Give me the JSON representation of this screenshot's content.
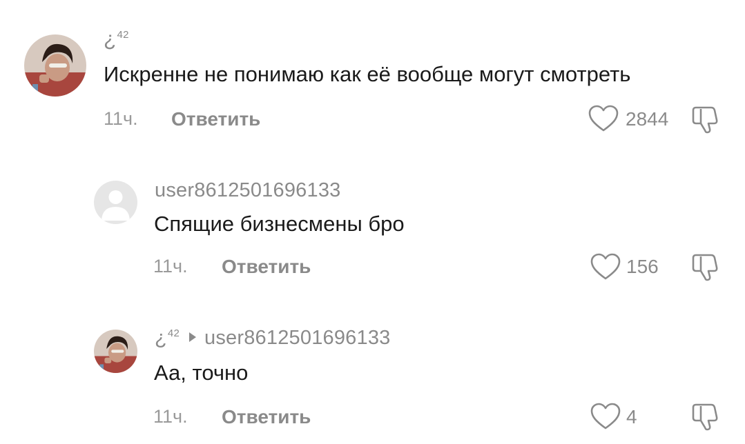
{
  "comments": [
    {
      "author": "¿",
      "author_sup": "42",
      "text": "Искренне не понимаю как её вообще могут смотреть",
      "time": "11ч.",
      "reply_label": "Ответить",
      "likes": "2844",
      "avatar": "photo-avatar"
    },
    {
      "author": "user8612501696133",
      "text": "Спящие бизнесмены бро",
      "time": "11ч.",
      "reply_label": "Ответить",
      "likes": "156",
      "avatar": "default-avatar"
    },
    {
      "author": "¿",
      "author_sup": "42",
      "reply_to": "user8612501696133",
      "text": "Аа, точно",
      "time": "11ч.",
      "reply_label": "Ответить",
      "likes": "4",
      "avatar": "photo-avatar"
    }
  ],
  "colors": {
    "text": "#1a1a1a",
    "meta": "#8a8a8a",
    "background": "#ffffff"
  },
  "icons": [
    "heart-outline-icon",
    "thumbs-down-icon",
    "reply-arrow-icon"
  ]
}
